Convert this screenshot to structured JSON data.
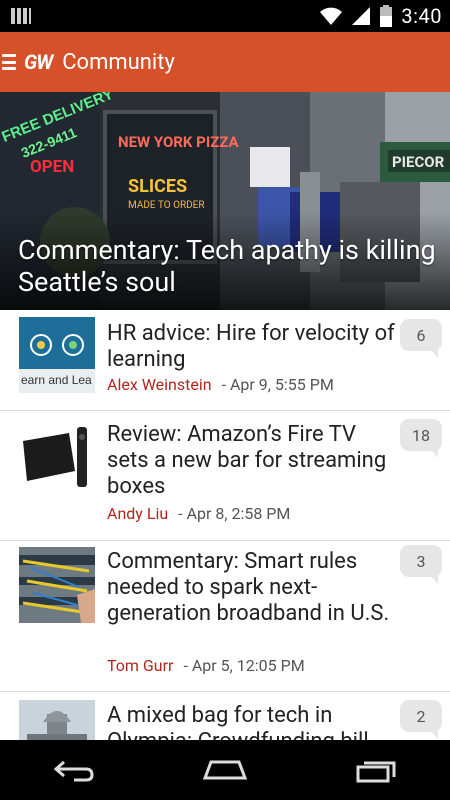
{
  "status_bar": {
    "time": "3:40"
  },
  "app_bar": {
    "logo": "GW",
    "title": "Community"
  },
  "hero": {
    "title": "Commentary: Tech apathy is killing Seattle’s soul"
  },
  "articles": [
    {
      "headline": "HR advice: Hire for velocity of learning",
      "author": "Alex Weinstein",
      "date": "- Apr 9, 5:55 PM",
      "comments": "6"
    },
    {
      "headline": "Review: Amazon’s Fire TV sets a new bar for streaming boxes",
      "author": "Andy Liu",
      "date": "- Apr 8, 2:58 PM",
      "comments": "18"
    },
    {
      "headline": "Commentary: Smart rules needed to spark next-generation broadband in U.S.",
      "author": "Tom Gurr",
      "date": "- Apr 5, 12:05 PM",
      "comments": "3"
    },
    {
      "headline": "A mixed bag for tech in Olympia: Crowdfunding bill",
      "author": "",
      "date": "",
      "comments": "2"
    }
  ],
  "thumb_text": {
    "item0": "earn and Lea"
  },
  "hero_signs": {
    "free_delivery": "FREE DELIVERY",
    "phone": "322-9411",
    "open": "OPEN",
    "pizza": "NEW YORK PIZZA",
    "slices": "SLICES",
    "made_to_order": "MADE TO ORDER",
    "piecora": "PIECOR"
  },
  "icons": [
    "notification-icon",
    "wifi-icon",
    "signal-icon",
    "battery-icon",
    "menu-icon",
    "back-icon",
    "home-icon",
    "recents-icon",
    "comment-bubble-icon"
  ]
}
